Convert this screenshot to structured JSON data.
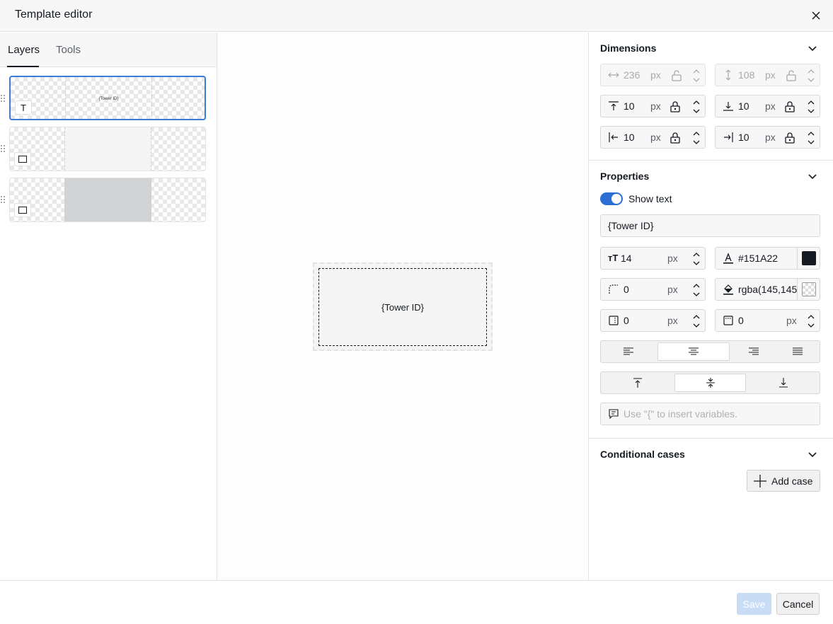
{
  "window": {
    "title": "Template editor"
  },
  "left_panel": {
    "tabs": [
      {
        "label": "Layers",
        "active": true
      },
      {
        "label": "Tools",
        "active": false
      }
    ],
    "layers": [
      {
        "type": "text",
        "preview_text": "{Tower ID}",
        "selected": true
      },
      {
        "type": "rectangle",
        "selected": false
      },
      {
        "type": "rectangle",
        "selected": false
      }
    ]
  },
  "canvas": {
    "element_text": "{Tower ID}"
  },
  "dimensions": {
    "title": "Dimensions",
    "width": {
      "value": "236",
      "unit": "px"
    },
    "height": {
      "value": "108",
      "unit": "px"
    },
    "margin_top": {
      "value": "10",
      "unit": "px"
    },
    "margin_bottom": {
      "value": "10",
      "unit": "px"
    },
    "margin_left": {
      "value": "10",
      "unit": "px"
    },
    "margin_right": {
      "value": "10",
      "unit": "px"
    }
  },
  "properties": {
    "title": "Properties",
    "show_text": {
      "label": "Show text",
      "on": true
    },
    "text_value": "{Tower ID}",
    "font_size": {
      "value": "14",
      "unit": "px"
    },
    "text_color": {
      "value": "#151A22"
    },
    "corner_radius": {
      "value": "0",
      "unit": "px"
    },
    "fill_color": {
      "value": "rgba(145,145"
    },
    "padding": {
      "value": "0",
      "unit": "px"
    },
    "border": {
      "value": "0",
      "unit": "px"
    },
    "horizontal_align": {
      "options": [
        "left",
        "center",
        "right",
        "justify"
      ],
      "selected": "center"
    },
    "vertical_align": {
      "options": [
        "top",
        "middle",
        "bottom"
      ],
      "selected": "middle"
    },
    "tooltip_placeholder": "Use \"{\" to insert variables."
  },
  "conditional": {
    "title": "Conditional cases",
    "add_label": "Add case"
  },
  "footer": {
    "save_label": "Save",
    "cancel_label": "Cancel"
  },
  "colors": {
    "accent": "#2b6fd4",
    "text": "#151A22",
    "save_disabled": "#c8ddf5"
  }
}
